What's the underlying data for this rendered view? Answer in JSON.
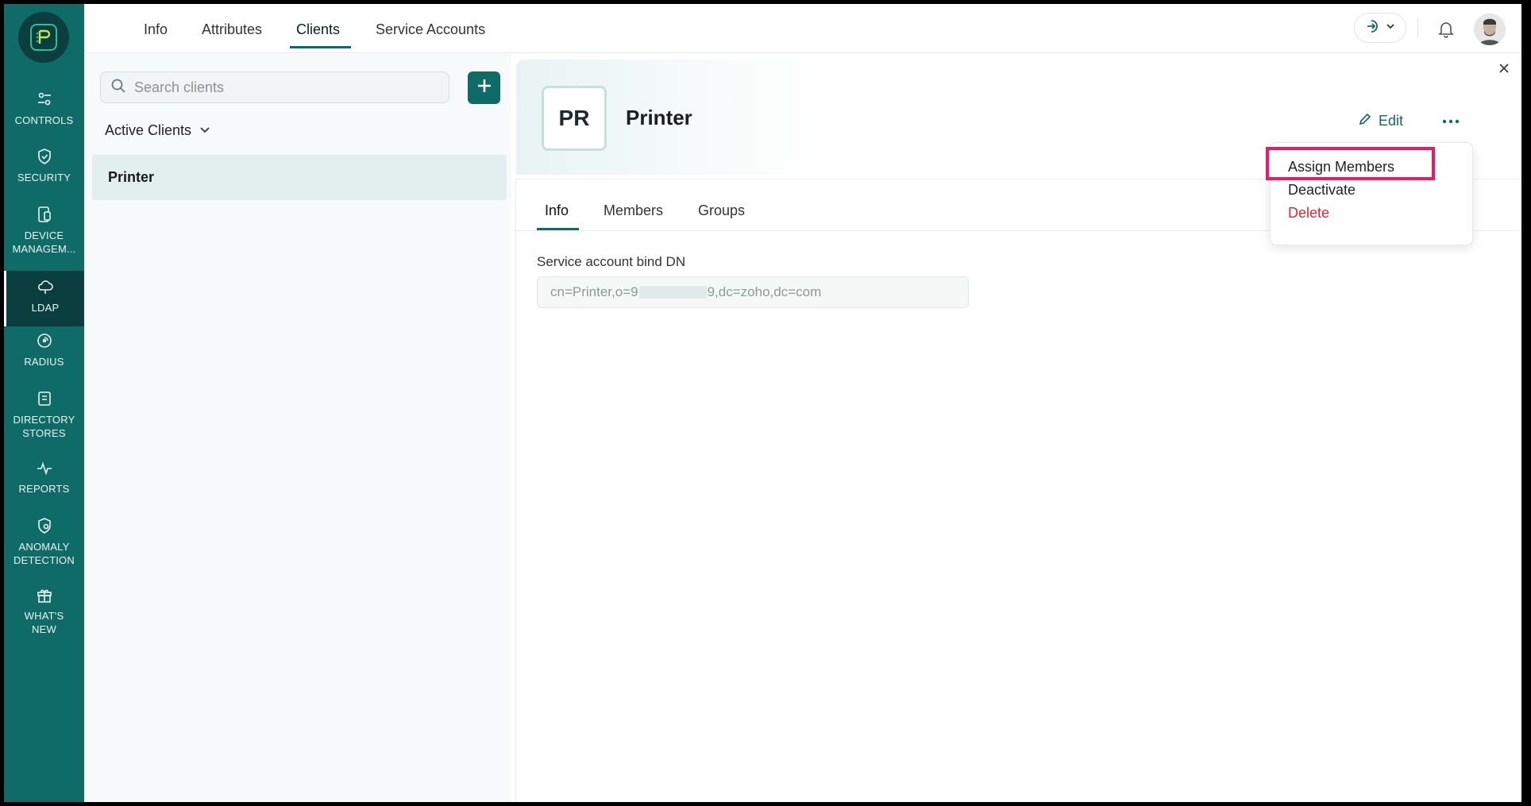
{
  "sidebar": {
    "items": [
      {
        "label": "CONTROLS",
        "icon": "sliders-icon"
      },
      {
        "label": "SECURITY",
        "icon": "shield-icon"
      },
      {
        "label": "DEVICE\nMANAGEM...",
        "icon": "device-icon"
      },
      {
        "label": "LDAP",
        "icon": "cloud-icon",
        "active": true
      },
      {
        "label": "RADIUS",
        "icon": "radius-icon"
      },
      {
        "label": "DIRECTORY\nSTORES",
        "icon": "book-icon"
      },
      {
        "label": "REPORTS",
        "icon": "pulse-icon"
      },
      {
        "label": "ANOMALY\nDETECTION",
        "icon": "shield-gear-icon"
      },
      {
        "label": "WHAT'S\nNEW",
        "icon": "gift-icon"
      }
    ]
  },
  "topnav": {
    "tabs": [
      "Info",
      "Attributes",
      "Clients",
      "Service Accounts"
    ],
    "active_tab": "Clients"
  },
  "clients_panel": {
    "search_placeholder": "Search clients",
    "filter_label": "Active Clients",
    "clients": [
      "Printer"
    ]
  },
  "detail": {
    "initials": "PR",
    "name": "Printer",
    "edit_label": "Edit",
    "tabs": [
      "Info",
      "Members",
      "Groups"
    ],
    "active_tab": "Info",
    "bind_dn_label": "Service account bind DN",
    "bind_dn_prefix": "cn=Printer,o=",
    "bind_dn_fragment": "9",
    "bind_dn_suffix": "9,dc=zoho,dc=com"
  },
  "menu": {
    "items": [
      "Assign Members",
      "Deactivate",
      "Delete"
    ]
  },
  "colors": {
    "brand": "#0f6b67",
    "danger": "#d9263a",
    "highlight": "#ec1a63"
  }
}
